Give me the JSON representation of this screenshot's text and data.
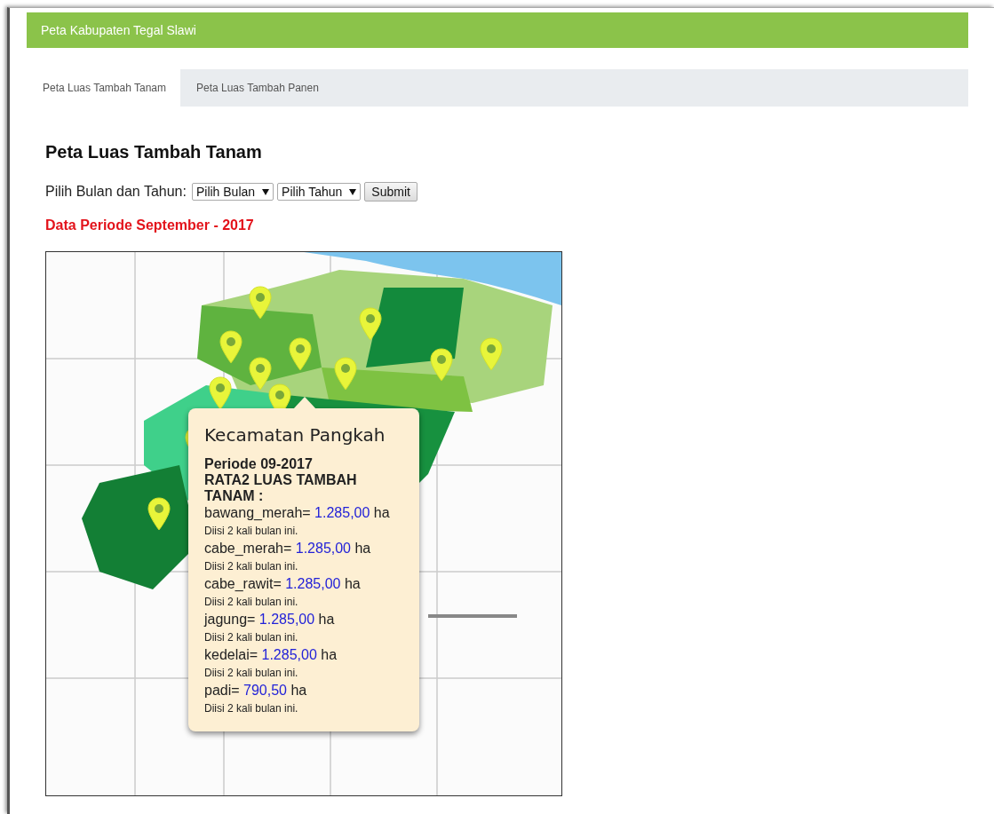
{
  "header": {
    "title": "Peta Kabupaten Tegal Slawi"
  },
  "tabs": [
    {
      "label": "Peta Luas Tambah Tanam",
      "selected": true
    },
    {
      "label": "Peta Luas Tambah Panen",
      "selected": false
    }
  ],
  "heading": "Peta Luas Tambah Tanam",
  "form": {
    "label": "Pilih Bulan dan Tahun:",
    "selects": [
      "Pilih Bulan",
      "Pilih Tahun"
    ],
    "submit": "Submit"
  },
  "period_title": "Data Periode September - 2017",
  "map": {
    "kind": "picture",
    "popup": {
      "title": "Kecamatan Pangkah",
      "period": "Periode 09-2017",
      "subtitle": "RATA2 LUAS TAMBAH TANAM :",
      "items": [
        {
          "name": "bawang_merah=",
          "value": "1.285,00",
          "unit": "ha",
          "note": "Diisi 2 kali bulan ini."
        },
        {
          "name": "cabe_merah=",
          "value": "1.285,00",
          "unit": "ha",
          "note": "Diisi 2 kali bulan ini."
        },
        {
          "name": "cabe_rawit=",
          "value": "1.285,00",
          "unit": "ha",
          "note": "Diisi 2 kali bulan ini."
        },
        {
          "name": "jagung=",
          "value": "1.285,00",
          "unit": "ha",
          "note": "Diisi 2 kali bulan ini."
        },
        {
          "name": "kedelai=",
          "value": "1.285,00",
          "unit": "ha",
          "note": "Diisi 2 kali bulan ini."
        },
        {
          "name": "padi=",
          "value": "790,50",
          "unit": "ha",
          "note": "Diisi 2 kali bulan ini."
        }
      ]
    }
  }
}
